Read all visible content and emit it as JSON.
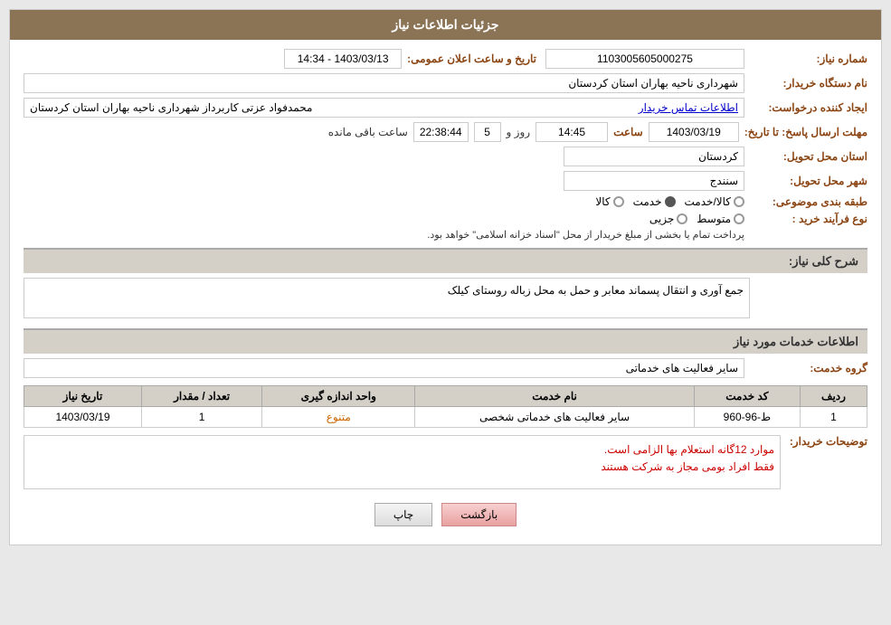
{
  "header": {
    "title": "جزئیات اطلاعات نیاز"
  },
  "fields": {
    "need_number_label": "شماره نیاز:",
    "need_number_value": "1103005605000275",
    "buyer_org_label": "نام دستگاه خریدار:",
    "buyer_org_value": "شهرداری ناحیه بهاران استان کردستان",
    "creator_label": "ایجاد کننده درخواست:",
    "creator_value": "محمدفواد عزتی کاربرداز شهرداری ناحیه بهاران استان کردستان",
    "creator_link": "اطلاعات تماس خریدار",
    "response_deadline_label": "مهلت ارسال پاسخ: تا تاریخ:",
    "response_date": "1403/03/19",
    "response_time_label": "ساعت",
    "response_time": "14:45",
    "response_day_label": "روز و",
    "response_days": "5",
    "remaining_time_label": "ساعت باقی مانده",
    "remaining_time": "22:38:44",
    "announce_label": "تاریخ و ساعت اعلان عمومی:",
    "announce_value": "1403/03/13 - 14:34",
    "delivery_province_label": "استان محل تحویل:",
    "delivery_province_value": "کردستان",
    "delivery_city_label": "شهر محل تحویل:",
    "delivery_city_value": "سنندج",
    "category_label": "طبقه بندی موضوعی:",
    "category_options": [
      "کالا",
      "خدمت",
      "کالا/خدمت"
    ],
    "category_selected": "خدمت",
    "process_label": "نوع فرآیند خرید :",
    "process_options": [
      "جزیی",
      "متوسط"
    ],
    "process_note": "پرداخت تمام یا بخشی از مبلغ خریدار از محل \"اسناد خزانه اسلامی\" خواهد بود.",
    "description_section_title": "شرح کلی نیاز:",
    "description_value": "جمع آوری و انتقال پسماند معابر و حمل به محل زباله روستای کیلک",
    "services_section_title": "اطلاعات خدمات مورد نیاز",
    "service_group_label": "گروه خدمت:",
    "service_group_value": "سایر فعالیت های خدماتی",
    "table": {
      "headers": [
        "ردیف",
        "کد خدمت",
        "نام خدمت",
        "واحد اندازه گیری",
        "تعداد / مقدار",
        "تاریخ نیاز"
      ],
      "rows": [
        {
          "row": "1",
          "code": "ط-96-960",
          "name": "سایر فعالیت های خدماتی شخصی",
          "unit": "متنوع",
          "quantity": "1",
          "date": "1403/03/19"
        }
      ]
    },
    "buyer_notes_label": "توضیحات خریدار:",
    "buyer_notes_line1": "موارد 12گانه استعلام بها الزامی است.",
    "buyer_notes_line2": "فقط افراد بومی مجاز به شرکت هستند"
  },
  "buttons": {
    "print_label": "چاپ",
    "back_label": "بازگشت"
  }
}
